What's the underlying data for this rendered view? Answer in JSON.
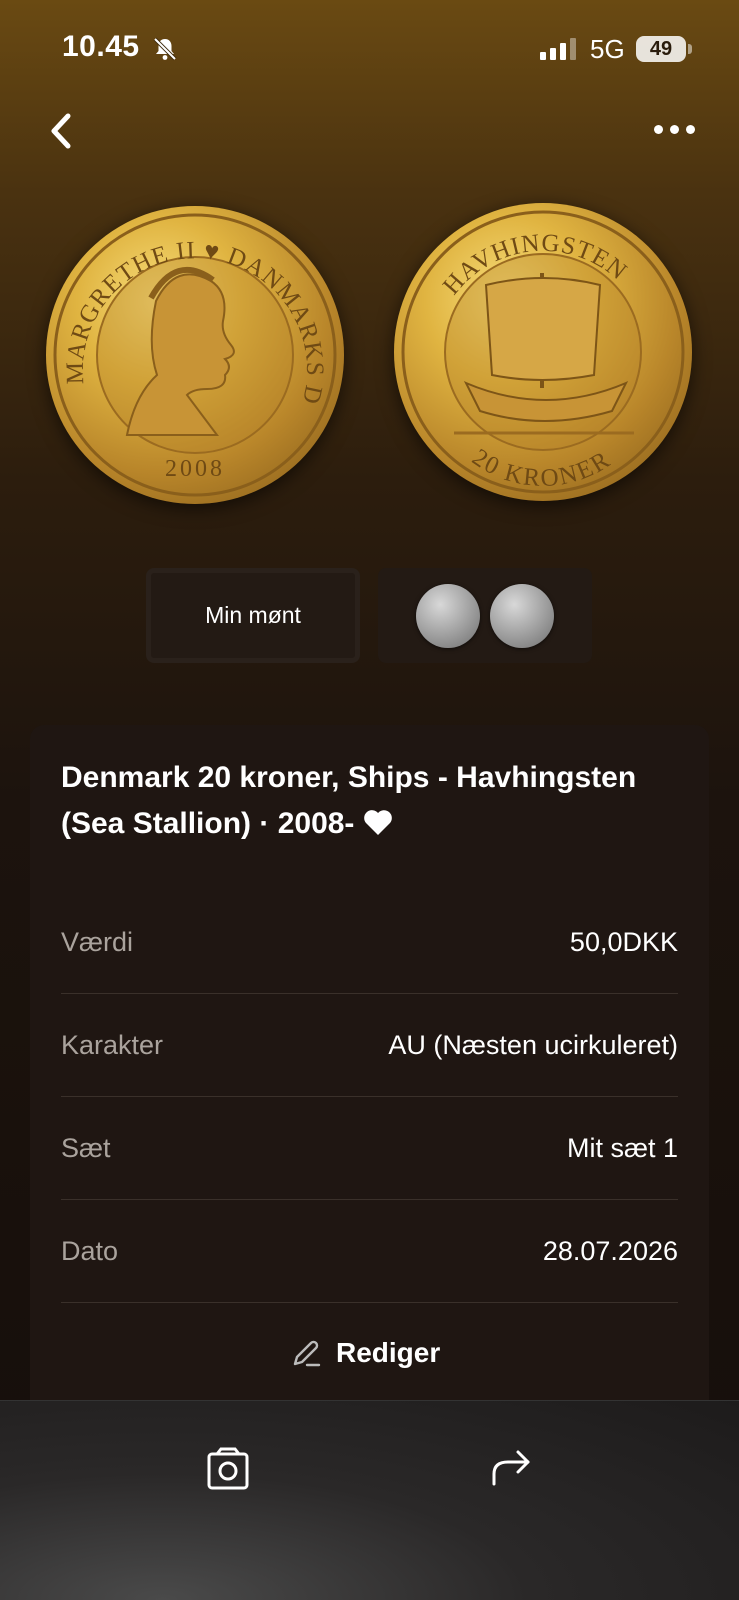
{
  "status_bar": {
    "time": "10.45",
    "network": "5G",
    "battery": "49"
  },
  "coin": {
    "obverse_legend": "MARGRETHE II ♥ DANMARKS DRONNING",
    "obverse_year": "2008",
    "reverse_legend": "HAVHINGSTEN",
    "reverse_denomination": "20 KRONER"
  },
  "tabs": {
    "mine_label": "Min mønt"
  },
  "details": {
    "title": "Denmark 20 kroner, Ships - Havhingsten (Sea Stallion) · 2008-",
    "rows": [
      {
        "label": "Værdi",
        "value": "50,0DKK"
      },
      {
        "label": "Karakter",
        "value": "AU (Næsten ucirkuleret)"
      },
      {
        "label": "Sæt",
        "value": "Mit sæt 1"
      },
      {
        "label": "Dato",
        "value": "28.07.2026"
      }
    ],
    "edit_label": "Rediger"
  },
  "icons": [
    "bell-off-icon",
    "signal-icon",
    "back-icon",
    "more-icon",
    "heart-icon",
    "pencil-icon",
    "photo-icon",
    "share-icon"
  ]
}
